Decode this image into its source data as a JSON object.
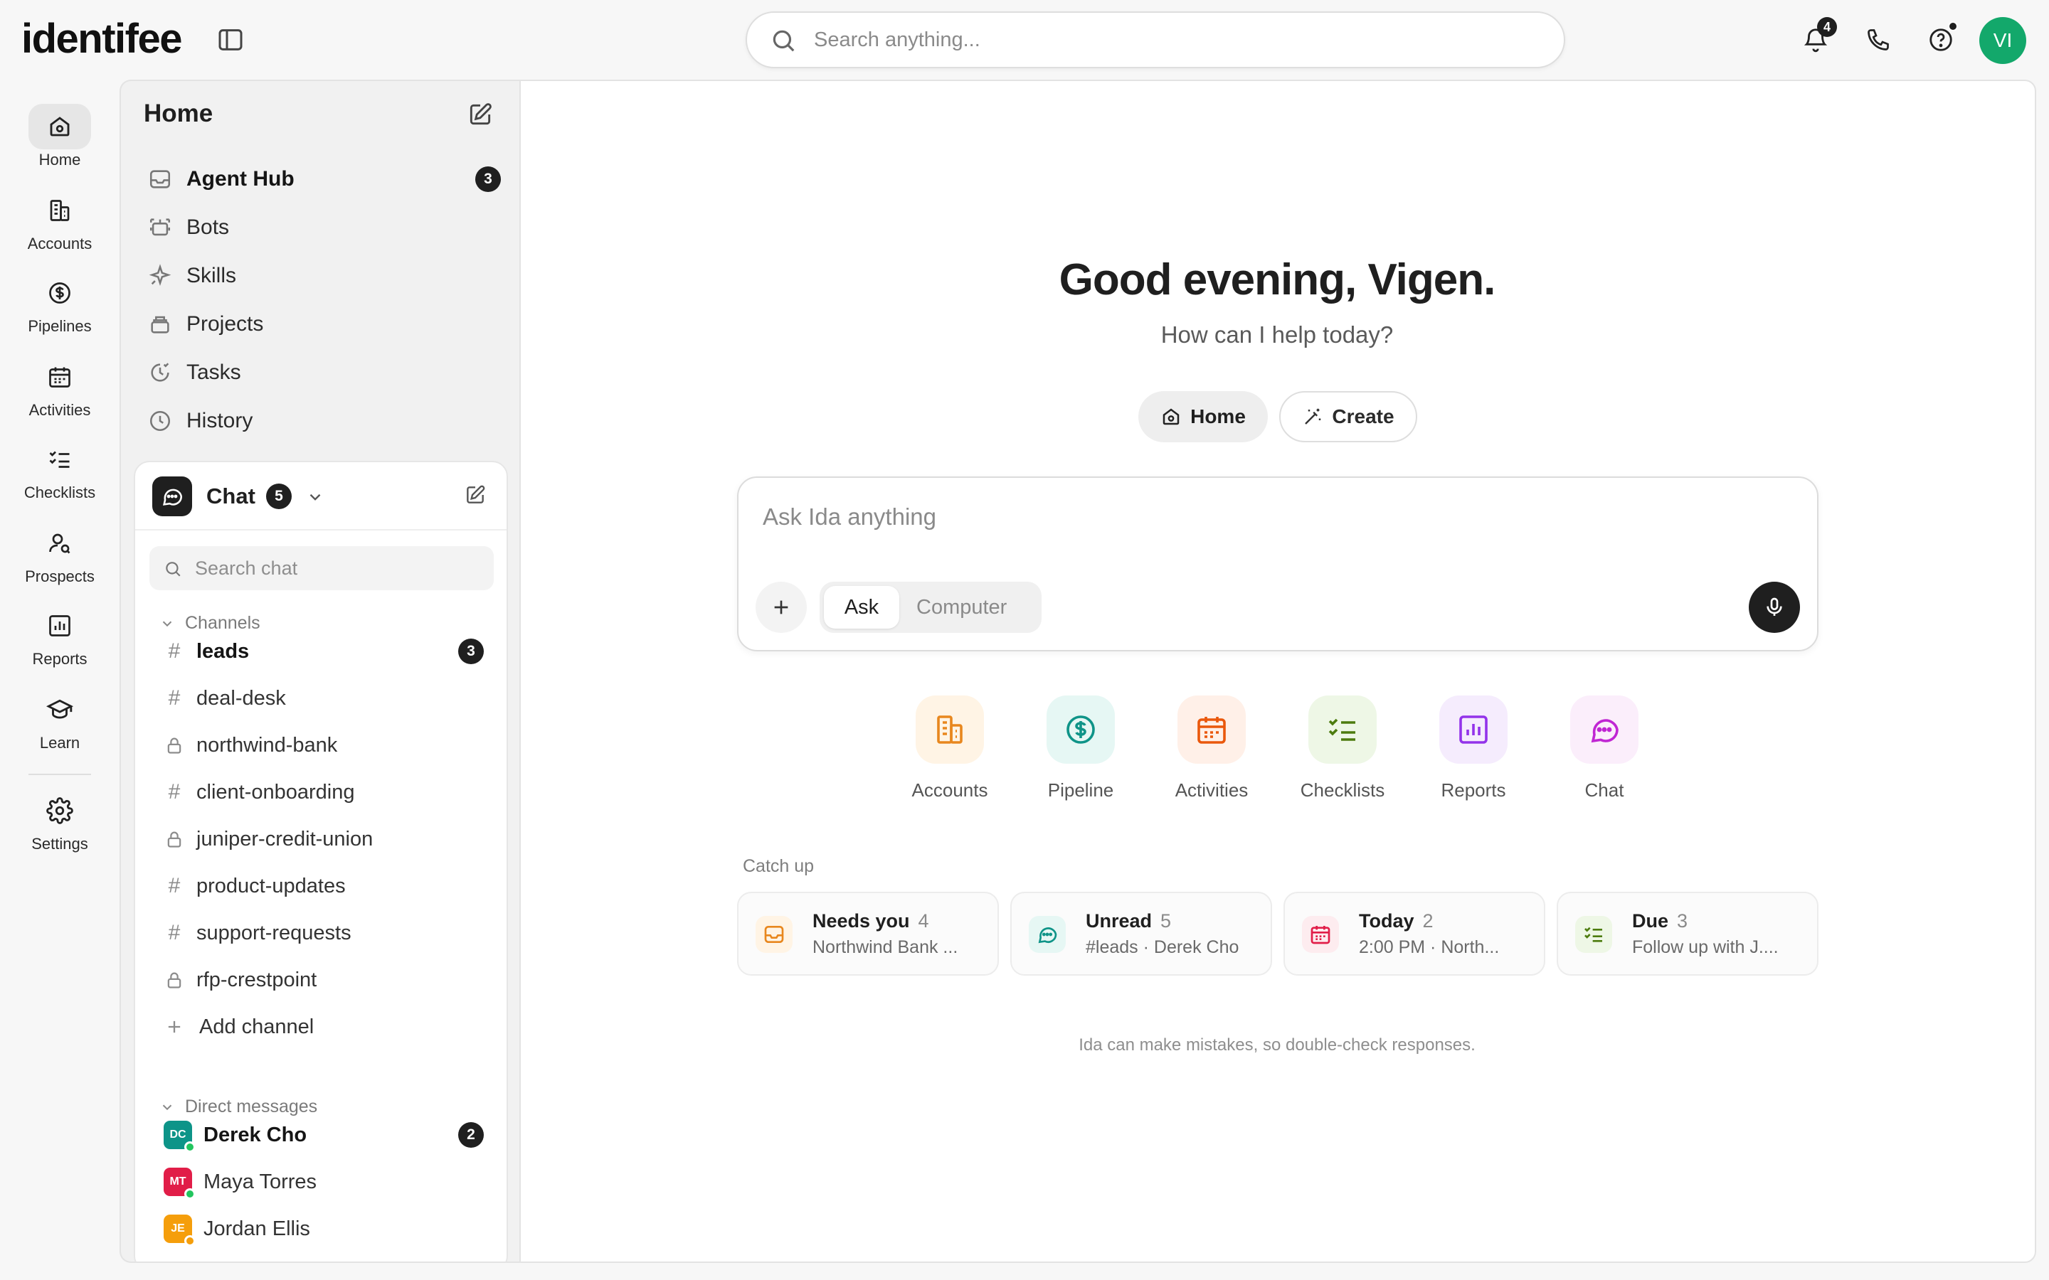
{
  "app": {
    "logo": "identifee"
  },
  "search": {
    "placeholder": "Search anything..."
  },
  "topbar": {
    "notifications_count": "4",
    "avatar_initials": "VI"
  },
  "rail": [
    {
      "label": "Home",
      "icon": "home-icon",
      "active": true
    },
    {
      "label": "Accounts",
      "icon": "building-icon"
    },
    {
      "label": "Pipelines",
      "icon": "dollar-circle-icon"
    },
    {
      "label": "Activities",
      "icon": "calendar-icon"
    },
    {
      "label": "Checklists",
      "icon": "checklist-icon"
    },
    {
      "label": "Prospects",
      "icon": "user-search-icon"
    },
    {
      "label": "Reports",
      "icon": "bar-chart-icon"
    },
    {
      "label": "Learn",
      "icon": "graduation-cap-icon"
    },
    {
      "label": "Settings",
      "icon": "gear-icon"
    }
  ],
  "panel": {
    "title": "Home",
    "nav": [
      {
        "label": "Agent Hub",
        "icon": "inbox-icon",
        "badge": "3",
        "bold": true
      },
      {
        "label": "Bots",
        "icon": "bot-icon"
      },
      {
        "label": "Skills",
        "icon": "sparkle-icon"
      },
      {
        "label": "Projects",
        "icon": "stack-icon"
      },
      {
        "label": "Tasks",
        "icon": "clock-check-icon"
      },
      {
        "label": "History",
        "icon": "history-icon"
      }
    ]
  },
  "chat": {
    "title": "Chat",
    "count": "5",
    "search_placeholder": "Search chat",
    "channels_header": "Channels",
    "channels": [
      {
        "name": "leads",
        "type": "public",
        "badge": "3",
        "bold": true
      },
      {
        "name": "deal-desk",
        "type": "public"
      },
      {
        "name": "northwind-bank",
        "type": "private"
      },
      {
        "name": "client-onboarding",
        "type": "public"
      },
      {
        "name": "juniper-credit-union",
        "type": "private"
      },
      {
        "name": "product-updates",
        "type": "public"
      },
      {
        "name": "support-requests",
        "type": "public"
      },
      {
        "name": "rfp-crestpoint",
        "type": "private"
      }
    ],
    "add_channel": "Add channel",
    "dm_header": "Direct messages",
    "dms": [
      {
        "name": "Derek Cho",
        "initials": "DC",
        "color": "#0d9488",
        "badge": "2",
        "bold": true
      },
      {
        "name": "Maya Torres",
        "initials": "MT",
        "color": "#e11d48"
      },
      {
        "name": "Jordan Ellis",
        "initials": "JE",
        "color": "#f59e0b"
      }
    ]
  },
  "main": {
    "greeting": "Good evening, Vigen.",
    "subtitle": "How can I help today?",
    "mode_home": "Home",
    "mode_create": "Create",
    "ask_placeholder": "Ask Ida anything",
    "seg_ask": "Ask",
    "seg_computer": "Computer",
    "quick_actions": [
      {
        "label": "Accounts",
        "icon": "building-icon",
        "bg": "#fff4e5",
        "fg": "#e8871e"
      },
      {
        "label": "Pipeline",
        "icon": "dollar-circle-icon",
        "bg": "#e6f7f4",
        "fg": "#0f9488"
      },
      {
        "label": "Activities",
        "icon": "calendar-icon",
        "bg": "#fff0e8",
        "fg": "#ea580c"
      },
      {
        "label": "Checklists",
        "icon": "checklist-icon",
        "bg": "#eef7e6",
        "fg": "#4d7c0f"
      },
      {
        "label": "Reports",
        "icon": "bar-chart-icon",
        "bg": "#f5ecfd",
        "fg": "#9333ea"
      },
      {
        "label": "Chat",
        "icon": "chat-icon",
        "bg": "#fbeefb",
        "fg": "#c026d3"
      }
    ],
    "catch_up_label": "Catch up",
    "catch_up": [
      {
        "title": "Needs you",
        "count": "4",
        "detail": "Northwind Bank ...",
        "icon": "inbox-icon",
        "bg": "#fff4e5",
        "fg": "#e8871e"
      },
      {
        "title": "Unread",
        "count": "5",
        "detail": "#leads · Derek Cho",
        "icon": "chat-icon",
        "bg": "#e6f7f4",
        "fg": "#0f9488"
      },
      {
        "title": "Today",
        "count": "2",
        "detail": "2:00 PM · North...",
        "icon": "calendar-icon",
        "bg": "#fdecef",
        "fg": "#e11d48"
      },
      {
        "title": "Due",
        "count": "3",
        "detail": "Follow up with J....",
        "icon": "checklist-icon",
        "bg": "#eef7e6",
        "fg": "#4d7c0f"
      }
    ],
    "disclaimer": "Ida can make mistakes, so double-check responses."
  }
}
